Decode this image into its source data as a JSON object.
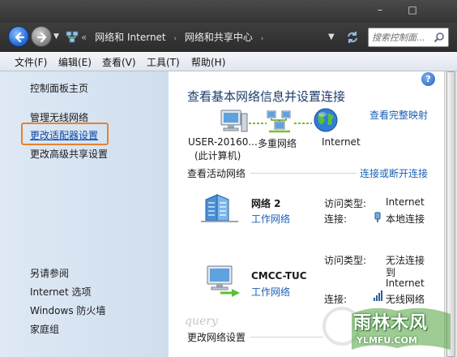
{
  "window": {
    "minimize_glyph": "–",
    "maximize_glyph": "□"
  },
  "address": {
    "breadcrumbs": [
      "网络和 Internet",
      "网络和共享中心"
    ],
    "separator": "›",
    "history_marker": "«",
    "dropdown_glyph": "▼",
    "search_placeholder": "搜索控制面..."
  },
  "menu": {
    "items": [
      "文件(F)",
      "编辑(E)",
      "查看(V)",
      "工具(T)",
      "帮助(H)"
    ]
  },
  "sidebar": {
    "items": [
      "控制面板主页",
      "管理无线网络",
      "更改适配器设置",
      "更改高级共享设置"
    ],
    "active_index": 2,
    "see_also": [
      "另请参阅",
      "Internet 选项",
      "Windows 防火墙",
      "家庭组"
    ]
  },
  "main": {
    "help_glyph": "?",
    "title": "查看基本网络信息并设置连接",
    "full_map_link": "查看完整映射",
    "map": {
      "computer_name": "USER-20160...",
      "computer_sub": "(此计算机)",
      "multi_network": "多重网络",
      "internet": "Internet"
    },
    "active_networks": {
      "title": "查看活动网络",
      "connect_link": "连接或断开连接",
      "networks": [
        {
          "name": "网络  2",
          "type": "工作网络",
          "access_label": "访问类型:",
          "access_value": "Internet",
          "conn_label": "连接:",
          "conn_value": "本地连接"
        },
        {
          "name": "CMCC-TUC",
          "type": "工作网络",
          "access_label": "访问类型:",
          "access_value_lines": [
            "无法连接",
            "到",
            "Internet"
          ],
          "conn_label": "连接:",
          "conn_value": "无线网络"
        }
      ]
    },
    "change_settings": "更改网络设置"
  },
  "watermark": {
    "brand": "雨林木风",
    "url": "YLMFU.COM",
    "script": "query"
  },
  "colors": {
    "link": "#1a5fb4",
    "highlight_box": "#e6812e",
    "title": "#1e3d6b"
  }
}
